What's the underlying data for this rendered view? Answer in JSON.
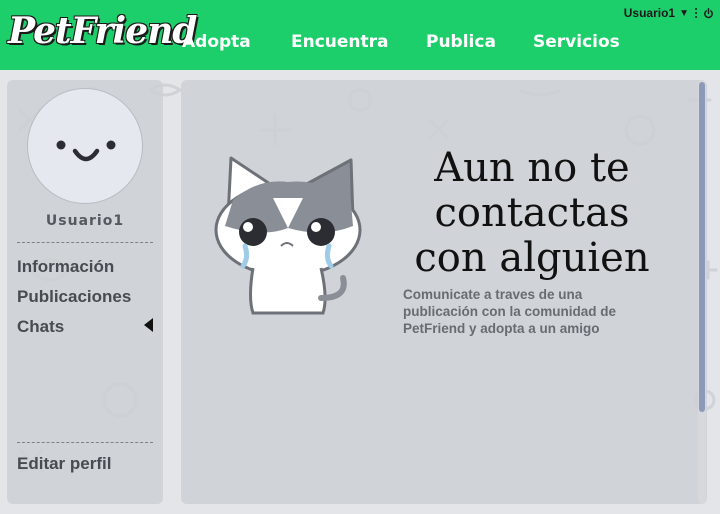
{
  "app": {
    "logo_text": "PetFriend"
  },
  "nav": {
    "items": [
      {
        "label": "Adopta"
      },
      {
        "label": "Encuentra"
      },
      {
        "label": "Publica"
      },
      {
        "label": "Servicios"
      }
    ]
  },
  "user_menu": {
    "username": "Usuario1",
    "caret_icon": "caret-down-icon",
    "more_icon": "kebab-menu-icon",
    "logout_icon": "power-icon"
  },
  "sidebar": {
    "avatar_icon": "smiley-avatar-icon",
    "username": "Usuario1",
    "menu": [
      {
        "label": "Información"
      },
      {
        "label": "Publicaciones"
      },
      {
        "label": "Chats",
        "active": true
      }
    ],
    "edit_profile": "Editar perfil"
  },
  "main": {
    "illustration": "crying-cat-illustration",
    "headline": "Aun no te contactas con alguien",
    "subtext": "Comunicate a traves de una publicación con la comunidad de PetFriend y adopta a un amigo"
  },
  "colors": {
    "topbar": "#1ccf6b",
    "panel": "#cdd0d4",
    "text_dark": "#111111",
    "text_muted": "#676c73"
  }
}
